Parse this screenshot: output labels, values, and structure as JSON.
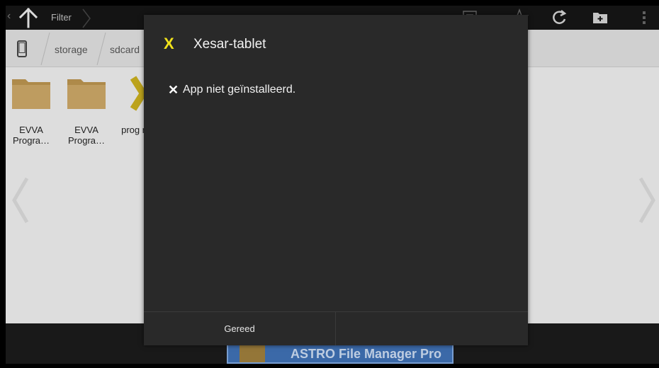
{
  "actionbar": {
    "back_glyph": "‹",
    "up_icon": "arrow-up-icon",
    "filter_label": "Filter",
    "actions": [
      "list-view-icon",
      "star-icon",
      "refresh-icon",
      "add-folder-icon",
      "overflow-menu-icon"
    ]
  },
  "breadcrumb": {
    "device_icon": "phone-icon",
    "items": [
      "storage",
      "sdcard"
    ]
  },
  "files": [
    {
      "label": "EVVA Progra…",
      "type": "folder"
    },
    {
      "label": "EVVA Progra…",
      "type": "folder"
    },
    {
      "label": "prog ming",
      "type": "app"
    }
  ],
  "ad": {
    "text": "ASTRO File Manager Pro"
  },
  "dialog": {
    "app_icon_glyph": "X",
    "title": "Xesar-tablet",
    "status_glyph": "✕",
    "message": "App niet geïnstalleerd.",
    "buttons": [
      "Gereed",
      ""
    ]
  },
  "colors": {
    "dialog_bg": "#292929",
    "accent_yellow": "#f1e21b",
    "actionbar_bg": "#161616"
  }
}
